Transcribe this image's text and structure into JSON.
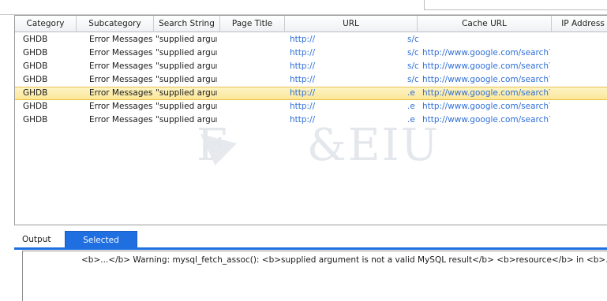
{
  "table": {
    "columns": [
      "Category",
      "Subcategory",
      "Search String",
      "Page Title",
      "URL",
      "Cache URL",
      "IP Address"
    ],
    "rows": [
      {
        "category": "GHDB",
        "subcategory": "Error Messages",
        "search_string": "\"supplied argun",
        "page_title": "",
        "url": "http://",
        "url_tail": "s/c",
        "cache_url": "",
        "ip": ""
      },
      {
        "category": "GHDB",
        "subcategory": "Error Messages",
        "search_string": "\"supplied argun",
        "page_title": "",
        "url": "http://",
        "url_tail": "s/c",
        "cache_url": "http://www.google.com/search?c",
        "ip": ""
      },
      {
        "category": "GHDB",
        "subcategory": "Error Messages",
        "search_string": "\"supplied argun",
        "page_title": "",
        "url": "http://",
        "url_tail": "s/c",
        "cache_url": "http://www.google.com/search?c",
        "ip": ""
      },
      {
        "category": "GHDB",
        "subcategory": "Error Messages",
        "search_string": "\"supplied argun",
        "page_title": "",
        "url": "http://",
        "url_tail": "s/c",
        "cache_url": "http://www.google.com/search?c",
        "ip": ""
      },
      {
        "category": "GHDB",
        "subcategory": "Error Messages",
        "search_string": "\"supplied argun",
        "page_title": "",
        "url": "http://",
        "url_tail": ".e",
        "cache_url": "http://www.google.com/search?c",
        "ip": ""
      },
      {
        "category": "GHDB",
        "subcategory": "Error Messages",
        "search_string": "\"supplied argun",
        "page_title": "",
        "url": "http://",
        "url_tail": ".e",
        "cache_url": "http://www.google.com/search?c",
        "ip": ""
      },
      {
        "category": "GHDB",
        "subcategory": "Error Messages",
        "search_string": "\"supplied argun",
        "page_title": "",
        "url": "http://",
        "url_tail": ".e",
        "cache_url": "http://www.google.com/search?c",
        "ip": ""
      }
    ],
    "selected_row_index": 4
  },
  "tabs": [
    {
      "label": "Output",
      "selected": false
    },
    {
      "label": "Selected Result",
      "selected": true
    }
  ],
  "detail": {
    "text": "<b>...</b> Warning: mysql_fetch_assoc(): <b>supplied argument is not a valid MySQL result</b>   <b>resource</b> in <b>...</b>"
  },
  "colors": {
    "accent": "#1f6fe0",
    "link": "#2f6fd8",
    "selection": "#fbe79a"
  }
}
